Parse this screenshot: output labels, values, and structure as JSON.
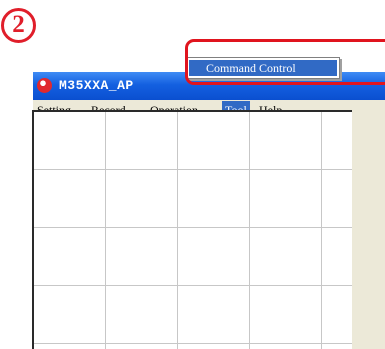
{
  "step_badge": "2",
  "window": {
    "title": "M35XXA_AP"
  },
  "menu": {
    "items": [
      "Setting",
      "Record",
      "Operation",
      "Tool",
      "Help"
    ]
  },
  "dropdown": {
    "items": [
      "Command Control"
    ]
  },
  "toolbar": {
    "icons": [
      "play-icon",
      "stop-icon",
      "command-control-icon"
    ]
  },
  "colors": {
    "titlebar": "#0a4fd0",
    "menu_highlight": "#316ac5",
    "annotation_red": "#e0141e",
    "window_face": "#ece9d8"
  }
}
